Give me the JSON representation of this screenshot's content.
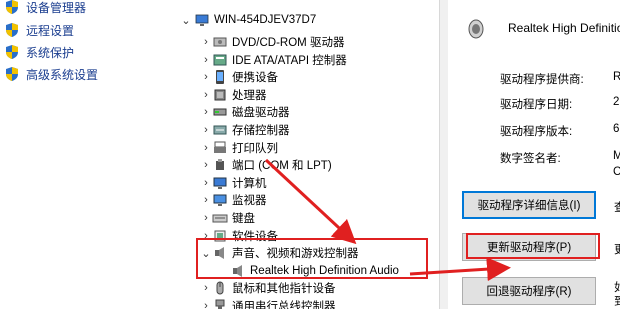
{
  "left_panel": {
    "links": [
      {
        "label": "设备管理器"
      },
      {
        "label": "远程设置"
      },
      {
        "label": "系统保护"
      },
      {
        "label": "高级系统设置"
      }
    ]
  },
  "tree": {
    "root": "WIN-454DJEV37D7",
    "items": [
      {
        "label": "DVD/CD-ROM 驱动器",
        "icon": "dvd-drive-icon"
      },
      {
        "label": "IDE ATA/ATAPI 控制器",
        "icon": "ide-controller-icon"
      },
      {
        "label": "便携设备",
        "icon": "portable-device-icon"
      },
      {
        "label": "处理器",
        "icon": "processor-icon"
      },
      {
        "label": "磁盘驱动器",
        "icon": "disk-drive-icon"
      },
      {
        "label": "存储控制器",
        "icon": "storage-controller-icon"
      },
      {
        "label": "打印队列",
        "icon": "printer-icon"
      },
      {
        "label": "端口 (COM 和 LPT)",
        "icon": "port-icon"
      },
      {
        "label": "计算机",
        "icon": "computer-icon"
      },
      {
        "label": "监视器",
        "icon": "monitor-icon"
      },
      {
        "label": "键盘",
        "icon": "keyboard-icon"
      },
      {
        "label": "软件设备",
        "icon": "software-device-icon"
      },
      {
        "label": "声音、视频和游戏控制器",
        "icon": "speaker-icon",
        "expanded": true
      },
      {
        "label": "Realtek High Definition Audio",
        "icon": "speaker-icon",
        "child": true
      },
      {
        "label": "鼠标和其他指针设备",
        "icon": "mouse-icon"
      },
      {
        "label": "通用串行总线控制器",
        "icon": "usb-icon"
      }
    ]
  },
  "props": {
    "device_name": "Realtek High Definition",
    "rows": [
      {
        "label": "驱动程序提供商:",
        "value": "R"
      },
      {
        "label": "驱动程序日期:",
        "value": "2("
      },
      {
        "label": "驱动程序版本:",
        "value": "6."
      },
      {
        "label": "数字签名者:",
        "value": "M"
      },
      {
        "label": "",
        "value": "C"
      }
    ],
    "buttons": {
      "details": "驱动程序详细信息(I)",
      "update": "更新驱动程序(P)",
      "rollback": "回退驱动程序(R)"
    },
    "side_chars": {
      "details": "查",
      "update": "更",
      "rollback_1": "如",
      "rollback_2": "到"
    }
  },
  "colors": {
    "annotation": "#e02020",
    "link": "#1a3d8f"
  }
}
